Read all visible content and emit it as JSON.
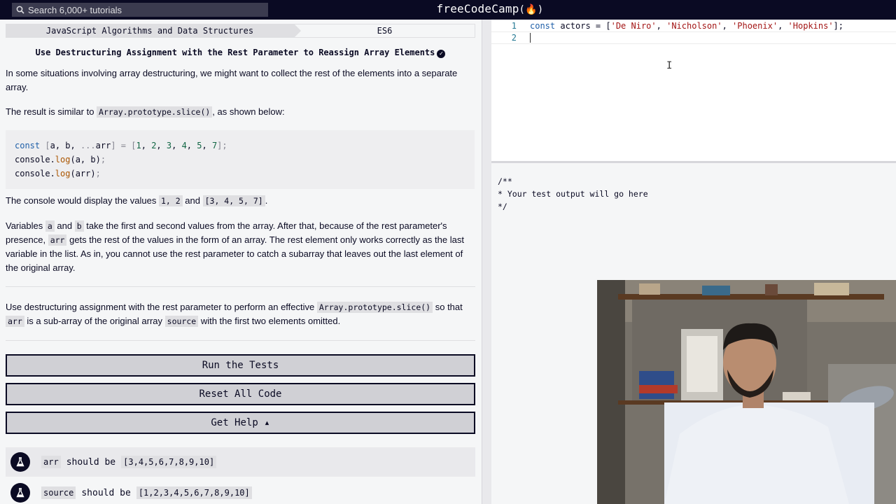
{
  "nav": {
    "search_placeholder": "Search 6,000+ tutorials",
    "logo_text": "freeCodeCamp",
    "logo_flame": "(🔥)"
  },
  "breadcrumb": {
    "superblock": "JavaScript Algorithms and Data Structures",
    "block": "ES6"
  },
  "challenge": {
    "title": "Use Destructuring Assignment with the Rest Parameter to Reassign Array Elements",
    "p1": "In some situations involving array destructuring, we might want to collect the rest of the elements into a separate array.",
    "p2_before": "The result is similar to ",
    "p2_code": "Array.prototype.slice()",
    "p2_after": ", as shown below:",
    "example_lines": [
      "const [a, b, ...arr] = [1, 2, 3, 4, 5, 7];",
      "console.log(a, b);",
      "console.log(arr);"
    ],
    "p3_before": "The console would display the values ",
    "p3_code1": "1, 2",
    "p3_mid": " and ",
    "p3_code2": "[3, 4, 5, 7]",
    "p3_after": ".",
    "p4_a": "Variables ",
    "p4_code_a": "a",
    "p4_b": " and ",
    "p4_code_b": "b",
    "p4_c": " take the first and second values from the array. After that, because of the rest parameter's presence, ",
    "p4_code_arr": "arr",
    "p4_d": " gets the rest of the values in the form of an array. The rest element only works correctly as the last variable in the list. As in, you cannot use the rest parameter to catch a subarray that leaves out the last element of the original array.",
    "p5_a": "Use destructuring assignment with the rest parameter to perform an effective ",
    "p5_code1": "Array.prototype.slice()",
    "p5_b": " so that ",
    "p5_code2": "arr",
    "p5_c": " is a sub-array of the original array ",
    "p5_code3": "source",
    "p5_d": " with the first two elements omitted."
  },
  "buttons": {
    "run": "Run the Tests",
    "reset": "Reset All Code",
    "help": "Get Help ▴"
  },
  "tests": [
    {
      "code1": "arr",
      "mid": "should be",
      "code2": "[3,4,5,6,7,8,9,10]"
    },
    {
      "code1": "source",
      "mid": "should be",
      "code2": "[1,2,3,4,5,6,7,8,9,10]"
    }
  ],
  "editor": {
    "line_numbers": [
      "1",
      "2"
    ],
    "line1_kw": "const",
    "line1_var": " actors = [",
    "line1_s1": "'De Niro'",
    "line1_s2": "'Nicholson'",
    "line1_s3": "'Phoenix'",
    "line1_s4": "'Hopkins'",
    "line1_end": "];",
    "comma": ", "
  },
  "output": {
    "text": "/**\n* Your test output will go here\n*/"
  },
  "colors": {
    "nav_bg": "#0a0a23",
    "panel_bg": "#f5f6f7",
    "button_bg": "#d0d0d5"
  }
}
